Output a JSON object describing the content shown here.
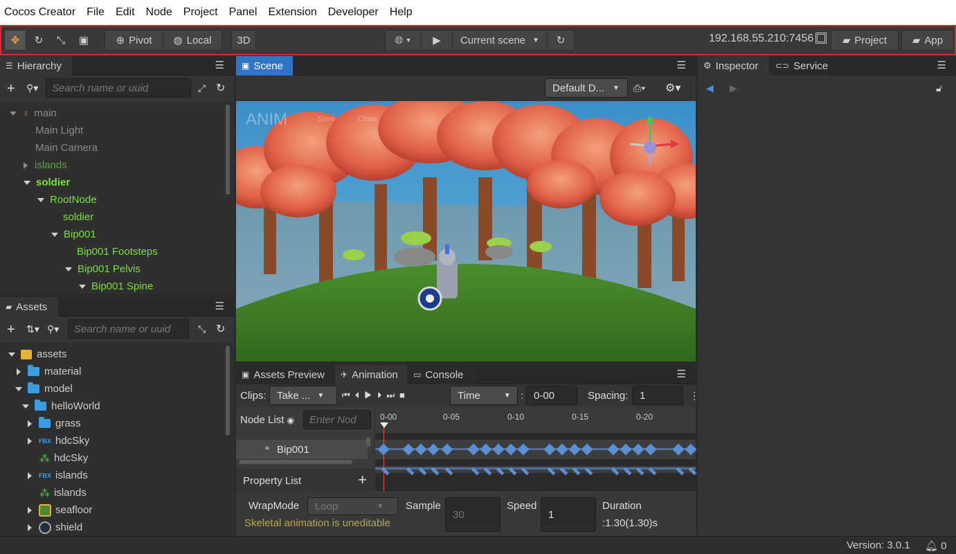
{
  "menubar": {
    "items": [
      "Cocos Creator",
      "File",
      "Edit",
      "Node",
      "Project",
      "Panel",
      "Extension",
      "Developer",
      "Help"
    ]
  },
  "toolbar": {
    "pivot_label": "Pivot",
    "local_label": "Local",
    "mode_3d_label": "3D",
    "scene_select": "Current scene",
    "ip_address": "192.168.55.210:7456",
    "project_label": "Project",
    "app_label": "App"
  },
  "hierarchy": {
    "tab_label": "Hierarchy",
    "search_placeholder": "Search name or uuid",
    "nodes": [
      "main",
      "Main Light",
      "Main Camera",
      "islands",
      "soldier",
      "RootNode",
      "soldier",
      "Bip001",
      "Bip001 Footsteps",
      "Bip001 Pelvis",
      "Bip001 Spine"
    ]
  },
  "assets": {
    "tab_label": "Assets",
    "search_placeholder": "Search name or uuid",
    "items": [
      "assets",
      "material",
      "model",
      "helloWorld",
      "grass",
      "hdcSky",
      "hdcSky",
      "islands",
      "islands",
      "seafloor",
      "shield"
    ],
    "fbx_badge": "FBX"
  },
  "scene": {
    "tab_label": "Scene",
    "camera_select": "Default D...",
    "anim_label": "ANIM",
    "anim_save": "Save",
    "anim_close": "Close"
  },
  "bottom_tabs": {
    "preview": "Assets Preview",
    "animation": "Animation",
    "console": "Console"
  },
  "animation": {
    "clips_label": "Clips:",
    "clip_value": "Take ...",
    "time_mode": "Time",
    "time_value": "0-00",
    "spacing_label": "Spacing:",
    "spacing_value": "1",
    "node_list_label": "Node List",
    "enter_node_placeholder": "Enter Nod",
    "ruler_ticks": [
      "0-00",
      "0-05",
      "0-10",
      "0-15",
      "0-20"
    ],
    "track_node": "Bip001",
    "property_list_label": "Property List",
    "wrapmode_label": "WrapMode",
    "wrapmode_value": "Loop",
    "sample_label": "Sample",
    "sample_value": "30",
    "speed_label": "Speed",
    "speed_value": "1",
    "duration_label": "Duration",
    "duration_value": ":1.30(1.30)s",
    "uneditable_msg": "Skeletal animation is uneditable"
  },
  "inspector": {
    "tab_label": "Inspector",
    "service_label": "Service"
  },
  "status": {
    "version": "Version: 3.0.1",
    "notifications": "0"
  },
  "colors": {
    "accent": "#e8242b",
    "node_green": "#7ddf3a",
    "active_tab": "#2f74c8",
    "warning_text": "#b7a64a"
  }
}
